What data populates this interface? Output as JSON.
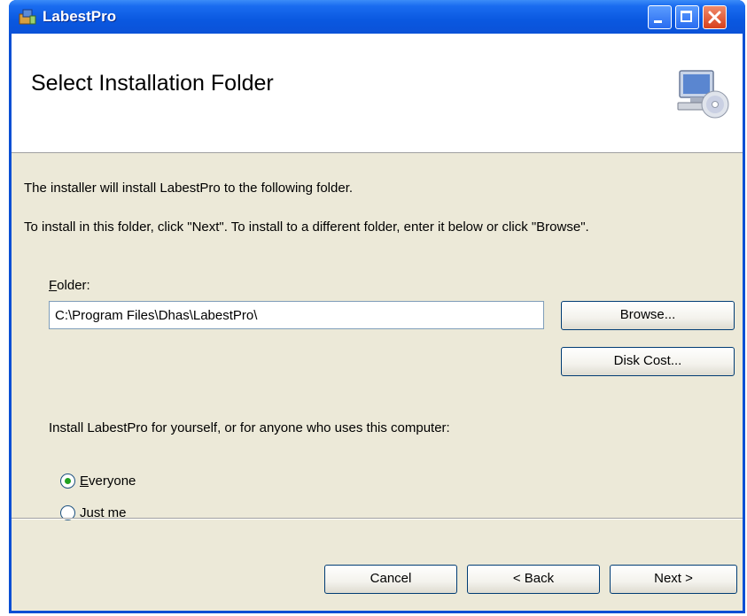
{
  "window": {
    "title": "LabestPro"
  },
  "banner": {
    "title": "Select Installation Folder",
    "icon": "computer-cd-icon"
  },
  "body": {
    "intro_line": "The installer will install LabestPro to the following folder.",
    "instruction_line": "To install in this folder, click \"Next\". To install to a different folder, enter it below or click \"Browse\".",
    "folder_label_mnemonic": "F",
    "folder_label_rest": "older:",
    "folder_value": "C:\\Program Files\\Dhas\\LabestPro\\",
    "browse_label": "Browse...",
    "disk_cost_label": "Disk Cost...",
    "install_for_label": "Install LabestPro for yourself, or for anyone who uses this computer:",
    "options": [
      {
        "mnemonic": "E",
        "rest": "veryone",
        "checked": true
      },
      {
        "mnemonic": "J",
        "rest": "ust me",
        "checked": false
      }
    ]
  },
  "footer": {
    "cancel_label": "Cancel",
    "back_label": "< Back",
    "next_label": "Next >"
  },
  "colors": {
    "titlebar": "#0a58e0",
    "dialog_bg": "#ece9d8",
    "close_button": "#d8401c",
    "radio_check": "#21a121"
  }
}
